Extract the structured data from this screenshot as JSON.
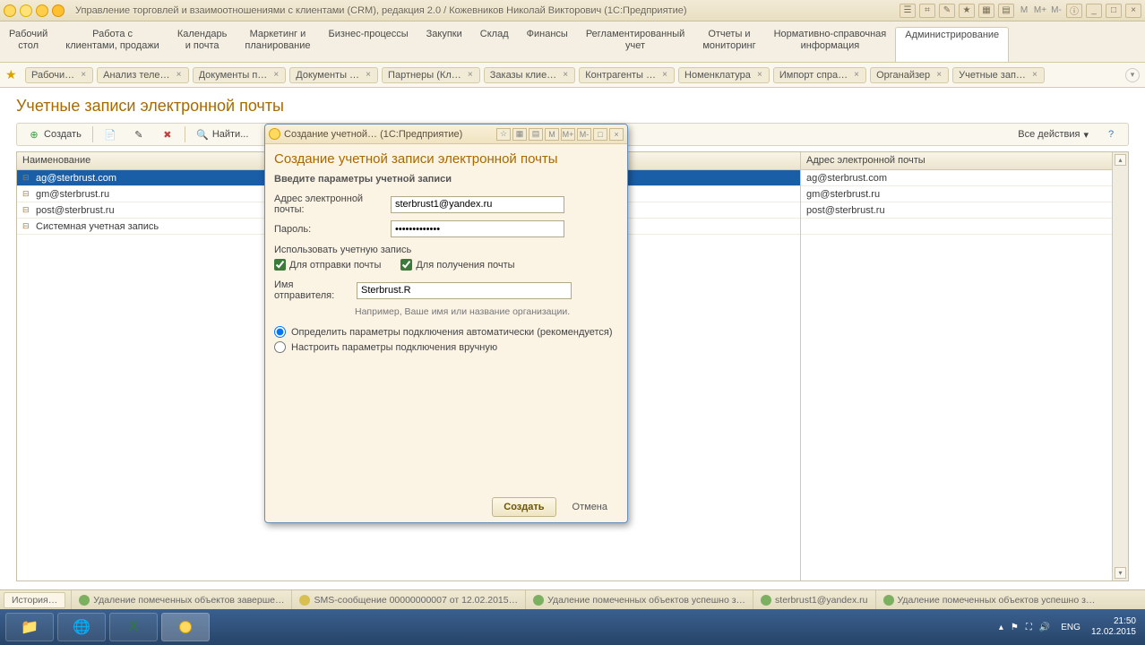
{
  "titlebar": {
    "title": "Управление торговлей и взаимоотношениями с клиентами (CRM), редакция 2.0 / Кожевников Николай Викторович  (1С:Предприятие)"
  },
  "sections": [
    "Рабочий\nстол",
    "Работа с\nклиентами, продажи",
    "Календарь\nи почта",
    "Маркетинг и\nпланирование",
    "Бизнес-процессы",
    "Закупки",
    "Склад",
    "Финансы",
    "Регламентированный\nучет",
    "Отчеты и\nмониторинг",
    "Нормативно-справочная\nинформация",
    "Администрирование"
  ],
  "tabs": [
    "Рабочи…",
    "Анализ теле…",
    "Документы п…",
    "Документы …",
    "Партнеры (Кл…",
    "Заказы клие…",
    "Контрагенты …",
    "Номенклатура",
    "Импорт спра…",
    "Органайзер",
    "Учетные зап…"
  ],
  "page": {
    "title": "Учетные записи электронной почты",
    "toolbar": {
      "create": "Создать",
      "find": "Найти...",
      "all_actions": "Все действия"
    },
    "columns": {
      "name": "Наименование",
      "email": "Адрес электронной почты"
    },
    "rows": [
      {
        "name": "ag@sterbrust.com",
        "email": "ag@sterbrust.com"
      },
      {
        "name": "gm@sterbrust.ru",
        "email": "gm@sterbrust.ru"
      },
      {
        "name": "post@sterbrust.ru",
        "email": "post@sterbrust.ru"
      },
      {
        "name": "Системная учетная запись",
        "email": ""
      }
    ]
  },
  "modal": {
    "wtitle": "Создание учетной…  (1С:Предприятие)",
    "title": "Создание учетной записи электронной почты",
    "subtitle": "Введите параметры учетной записи",
    "email_label": "Адрес электронной почты:",
    "email_value": "sterbrust1@yandex.ru",
    "password_label": "Пароль:",
    "password_value": "•••••••••••••",
    "use_label": "Использовать учетную запись",
    "send_label": "Для отправки почты",
    "recv_label": "Для получения почты",
    "sender_label": "Имя отправителя:",
    "sender_value": "Sterbrust.R",
    "sender_hint": "Например, Ваше имя или название организации.",
    "opt_auto": "Определить параметры подключения автоматически (рекомендуется)",
    "opt_manual": "Настроить параметры подключения вручную",
    "btn_create": "Создать",
    "btn_cancel": "Отмена"
  },
  "status": {
    "history": "История…",
    "s1": "Удаление помеченных объектов заверше…",
    "s2": "SMS-сообщение 00000000007 от 12.02.2015…",
    "s3": "Удаление помеченных объектов успешно з…",
    "s4": "sterbrust1@yandex.ru",
    "s5": "Удаление помеченных объектов успешно з…"
  },
  "taskbar": {
    "lang": "ENG",
    "time": "21:50",
    "date": "12.02.2015"
  }
}
